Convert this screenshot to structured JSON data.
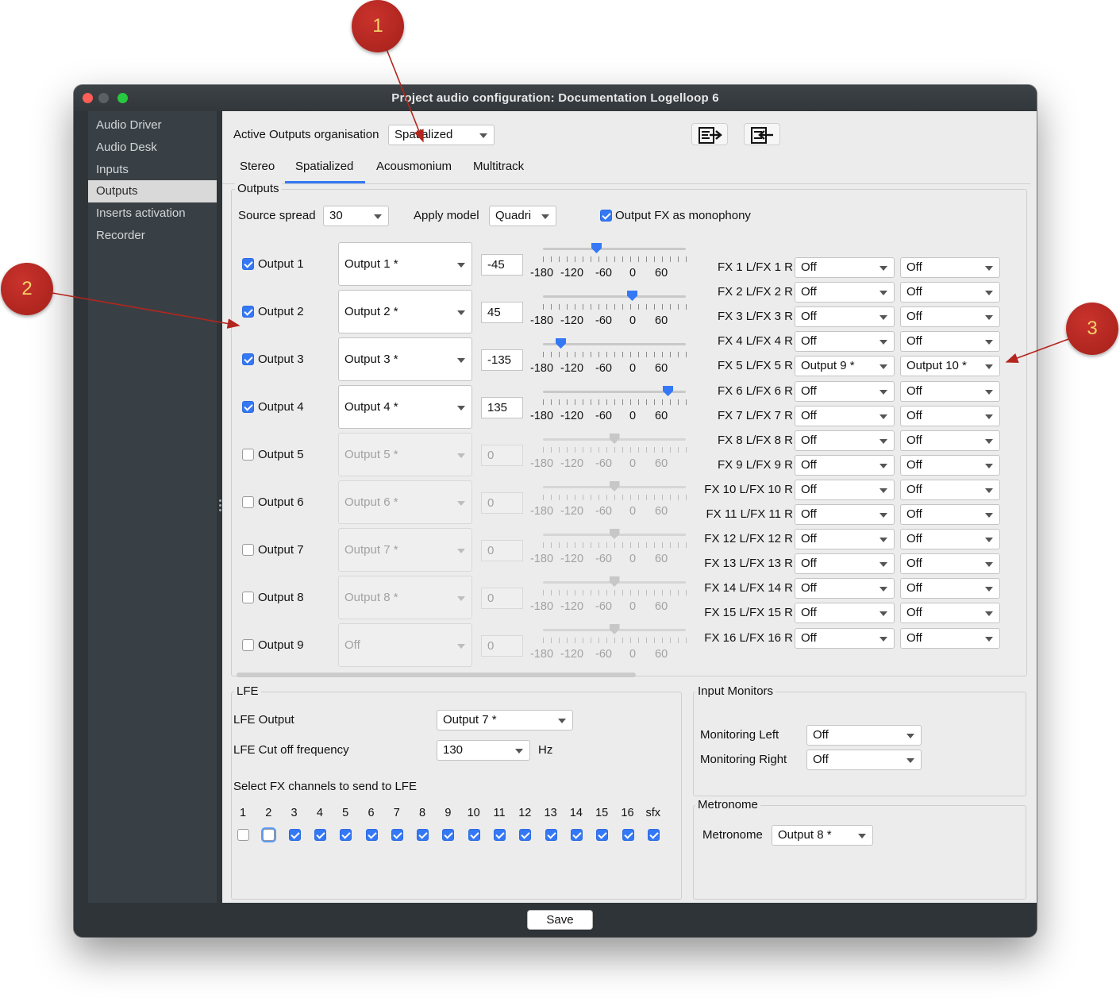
{
  "window": {
    "title": "Project audio configuration: Documentation Logelloop 6"
  },
  "sidebar": {
    "items": [
      {
        "label": "Audio Driver"
      },
      {
        "label": "Audio Desk"
      },
      {
        "label": "Inputs"
      },
      {
        "label": "Outputs"
      },
      {
        "label": "Inserts activation"
      },
      {
        "label": "Recorder"
      }
    ],
    "active": "Outputs"
  },
  "header": {
    "organisation_label": "Active Outputs organisation",
    "organisation_value": "Spatialized",
    "export_icon": "export-config-icon",
    "import_icon": "import-config-icon"
  },
  "tabs": [
    {
      "label": "Stereo"
    },
    {
      "label": "Spatialized"
    },
    {
      "label": "Acousmonium"
    },
    {
      "label": "Multitrack"
    }
  ],
  "active_tab": "Spatialized",
  "outputs": {
    "group_title": "Outputs",
    "source_spread_label": "Source spread",
    "source_spread_value": "30",
    "apply_model_label": "Apply model",
    "apply_model_value": "Quadri",
    "fx_mono_label": "Output FX as monophony",
    "fx_mono_checked": true,
    "scale_labels": [
      "-180",
      "-120",
      "-60",
      "0",
      "60"
    ],
    "slider_range": [
      -180,
      180
    ],
    "rows": [
      {
        "label": "Output 1",
        "checked": true,
        "routing": "Output 1 *",
        "angle": "-45",
        "slider": -45
      },
      {
        "label": "Output 2",
        "checked": true,
        "routing": "Output 2 *",
        "angle": "45",
        "slider": 45
      },
      {
        "label": "Output 3",
        "checked": true,
        "routing": "Output 3 *",
        "angle": "-135",
        "slider": -135
      },
      {
        "label": "Output 4",
        "checked": true,
        "routing": "Output 4 *",
        "angle": "135",
        "slider": 135
      },
      {
        "label": "Output 5",
        "checked": false,
        "routing": "Output 5 *",
        "angle": "0",
        "slider": 0
      },
      {
        "label": "Output 6",
        "checked": false,
        "routing": "Output 6 *",
        "angle": "0",
        "slider": 0
      },
      {
        "label": "Output 7",
        "checked": false,
        "routing": "Output 7 *",
        "angle": "0",
        "slider": 0
      },
      {
        "label": "Output 8",
        "checked": false,
        "routing": "Output 8 *",
        "angle": "0",
        "slider": 0
      },
      {
        "label": "Output 9",
        "checked": false,
        "routing": "Off",
        "angle": "0",
        "slider": 0
      }
    ],
    "fx_rows": [
      {
        "label": "FX 1 L/FX 1 R",
        "left": "Off",
        "right": "Off"
      },
      {
        "label": "FX 2 L/FX 2 R",
        "left": "Off",
        "right": "Off"
      },
      {
        "label": "FX 3 L/FX 3 R",
        "left": "Off",
        "right": "Off"
      },
      {
        "label": "FX 4 L/FX 4 R",
        "left": "Off",
        "right": "Off"
      },
      {
        "label": "FX 5 L/FX 5 R",
        "left": "Output 9 *",
        "right": "Output 10 *"
      },
      {
        "label": "FX 6 L/FX 6 R",
        "left": "Off",
        "right": "Off"
      },
      {
        "label": "FX 7 L/FX 7 R",
        "left": "Off",
        "right": "Off"
      },
      {
        "label": "FX 8 L/FX 8 R",
        "left": "Off",
        "right": "Off"
      },
      {
        "label": "FX 9 L/FX 9 R",
        "left": "Off",
        "right": "Off"
      },
      {
        "label": "FX 10 L/FX 10 R",
        "left": "Off",
        "right": "Off"
      },
      {
        "label": "FX 11 L/FX 11 R",
        "left": "Off",
        "right": "Off"
      },
      {
        "label": "FX 12 L/FX 12 R",
        "left": "Off",
        "right": "Off"
      },
      {
        "label": "FX 13 L/FX 13 R",
        "left": "Off",
        "right": "Off"
      },
      {
        "label": "FX 14 L/FX 14 R",
        "left": "Off",
        "right": "Off"
      },
      {
        "label": "FX 15 L/FX 15 R",
        "left": "Off",
        "right": "Off"
      },
      {
        "label": "FX 16 L/FX 16 R",
        "left": "Off",
        "right": "Off"
      }
    ]
  },
  "lfe": {
    "group_title": "LFE",
    "output_label": "LFE Output",
    "output_value": "Output 7 *",
    "cutoff_label": "LFE Cut off frequency",
    "cutoff_value": "130",
    "cutoff_unit": "Hz",
    "fx_channels_label": "Select FX channels to send to LFE",
    "channels": [
      {
        "label": "1",
        "checked": false
      },
      {
        "label": "2",
        "checked": false
      },
      {
        "label": "3",
        "checked": true
      },
      {
        "label": "4",
        "checked": true
      },
      {
        "label": "5",
        "checked": true
      },
      {
        "label": "6",
        "checked": true
      },
      {
        "label": "7",
        "checked": true
      },
      {
        "label": "8",
        "checked": true
      },
      {
        "label": "9",
        "checked": true
      },
      {
        "label": "10",
        "checked": true
      },
      {
        "label": "11",
        "checked": true
      },
      {
        "label": "12",
        "checked": true
      },
      {
        "label": "13",
        "checked": true
      },
      {
        "label": "14",
        "checked": true
      },
      {
        "label": "15",
        "checked": true
      },
      {
        "label": "16",
        "checked": true
      },
      {
        "label": "sfx",
        "checked": true
      }
    ]
  },
  "input_monitors": {
    "group_title": "Input Monitors",
    "left_label": "Monitoring Left",
    "left_value": "Off",
    "right_label": "Monitoring Right",
    "right_value": "Off"
  },
  "metronome": {
    "group_title": "Metronome",
    "label": "Metronome",
    "value": "Output 8 *"
  },
  "footer": {
    "save_label": "Save"
  },
  "callouts": [
    {
      "label": "1"
    },
    {
      "label": "2"
    },
    {
      "label": "3"
    }
  ],
  "colors": {
    "accent": "#3478f6",
    "callout": "#b3261e",
    "sidebar_bg": "#394045",
    "panel_bg": "#ececec"
  }
}
